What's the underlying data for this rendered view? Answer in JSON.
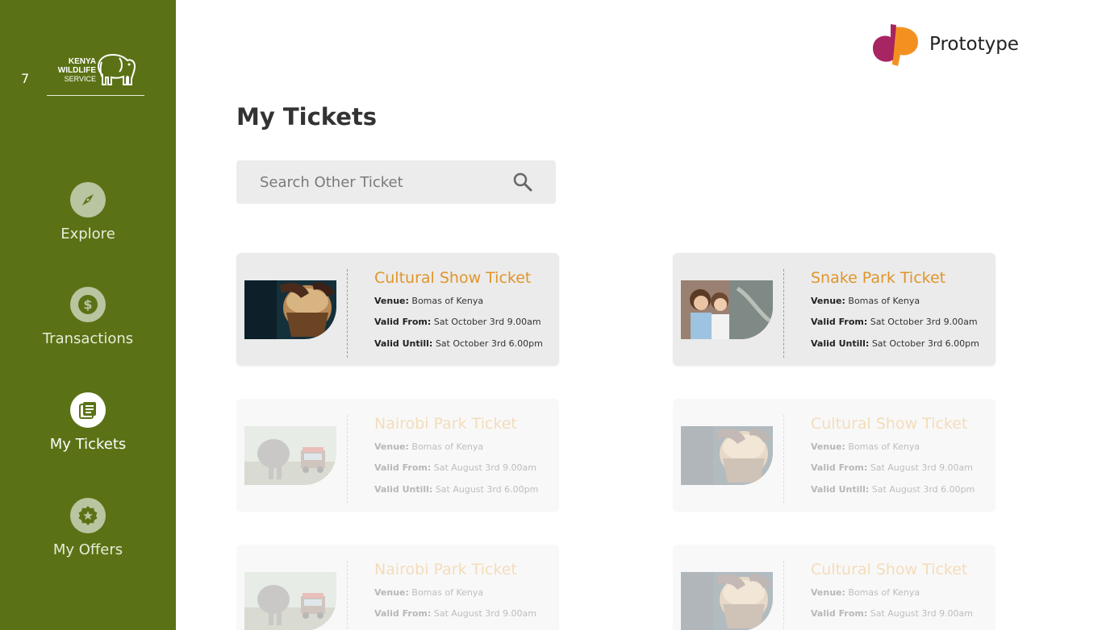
{
  "sidebar": {
    "badge": "7",
    "logo": {
      "line1": "KENYA",
      "line2": "WILDLIFE",
      "line3": "SERVICE"
    },
    "items": [
      {
        "label": "Explore",
        "icon": "compass-icon",
        "active": false
      },
      {
        "label": "Transactions",
        "icon": "dollar-icon",
        "active": false
      },
      {
        "label": "My Tickets",
        "icon": "tickets-icon",
        "active": true
      },
      {
        "label": "My Offers",
        "icon": "star-badge-icon",
        "active": false
      }
    ]
  },
  "brand": {
    "name": "Prototype"
  },
  "page": {
    "title": "My Tickets"
  },
  "search": {
    "placeholder": "Search Other Ticket",
    "value": ""
  },
  "labels": {
    "venue": "Venue:",
    "valid_from": "Valid From:",
    "valid_until": "Valid Untill:"
  },
  "tickets": [
    {
      "title": "Cultural Show Ticket",
      "venue": "Bomas of Kenya",
      "valid_from": "Sat October 3rd 9.00am",
      "valid_until": "Sat October 3rd 6.00pm",
      "image": "drum",
      "faded": false
    },
    {
      "title": "Snake Park Ticket",
      "venue": "Bomas of Kenya",
      "valid_from": "Sat October 3rd 9.00am",
      "valid_until": "Sat October 3rd 6.00pm",
      "image": "kids",
      "faded": false
    },
    {
      "title": "Nairobi Park Ticket",
      "venue": "Bomas of Kenya",
      "valid_from": "Sat August 3rd 9.00am",
      "valid_until": "Sat August 3rd 6.00pm",
      "image": "elephant",
      "faded": true
    },
    {
      "title": "Cultural Show Ticket",
      "venue": "Bomas of Kenya",
      "valid_from": "Sat August 3rd 9.00am",
      "valid_until": "Sat August 3rd 6.00pm",
      "image": "drum",
      "faded": true
    },
    {
      "title": "Nairobi Park Ticket",
      "venue": "Bomas of Kenya",
      "valid_from": "Sat August 3rd 9.00am",
      "valid_until": "",
      "image": "elephant",
      "faded": true
    },
    {
      "title": "Cultural Show Ticket",
      "venue": "Bomas of Kenya",
      "valid_from": "Sat August 3rd 9.00am",
      "valid_until": "",
      "image": "drum",
      "faded": true
    }
  ],
  "colors": {
    "sidebar": "#5a7215",
    "accent": "#e0952a",
    "brand_magenta": "#a3195b",
    "brand_orange": "#f39120"
  }
}
